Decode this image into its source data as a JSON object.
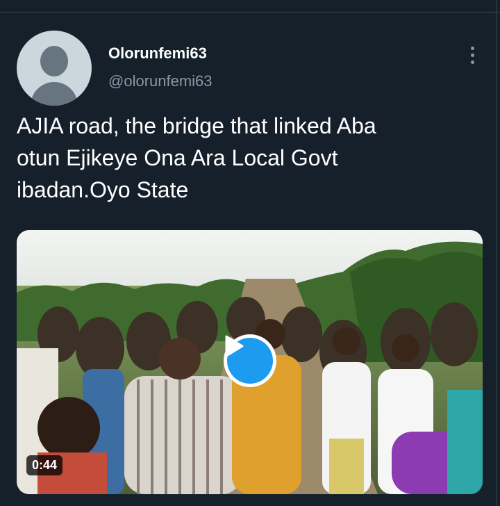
{
  "tweet": {
    "display_name": "Olorunfemi63",
    "handle": "@olorunfemi63",
    "text_lines": [
      "AJIA road, the bridge that linked Aba",
      "otun Ejikeye Ona Ara Local Govt",
      "ibadan.Oyo State"
    ],
    "media": {
      "type": "video",
      "duration": "0:44",
      "description_icon": "play-icon"
    }
  },
  "colors": {
    "background": "#15202b",
    "text_primary": "#ffffff",
    "text_secondary": "#8b98a5",
    "accent": "#1d9bf0",
    "divider": "#38444d"
  },
  "icons": {
    "more": "more-vertical-icon",
    "play": "play-icon",
    "avatar": "default-avatar-icon"
  }
}
